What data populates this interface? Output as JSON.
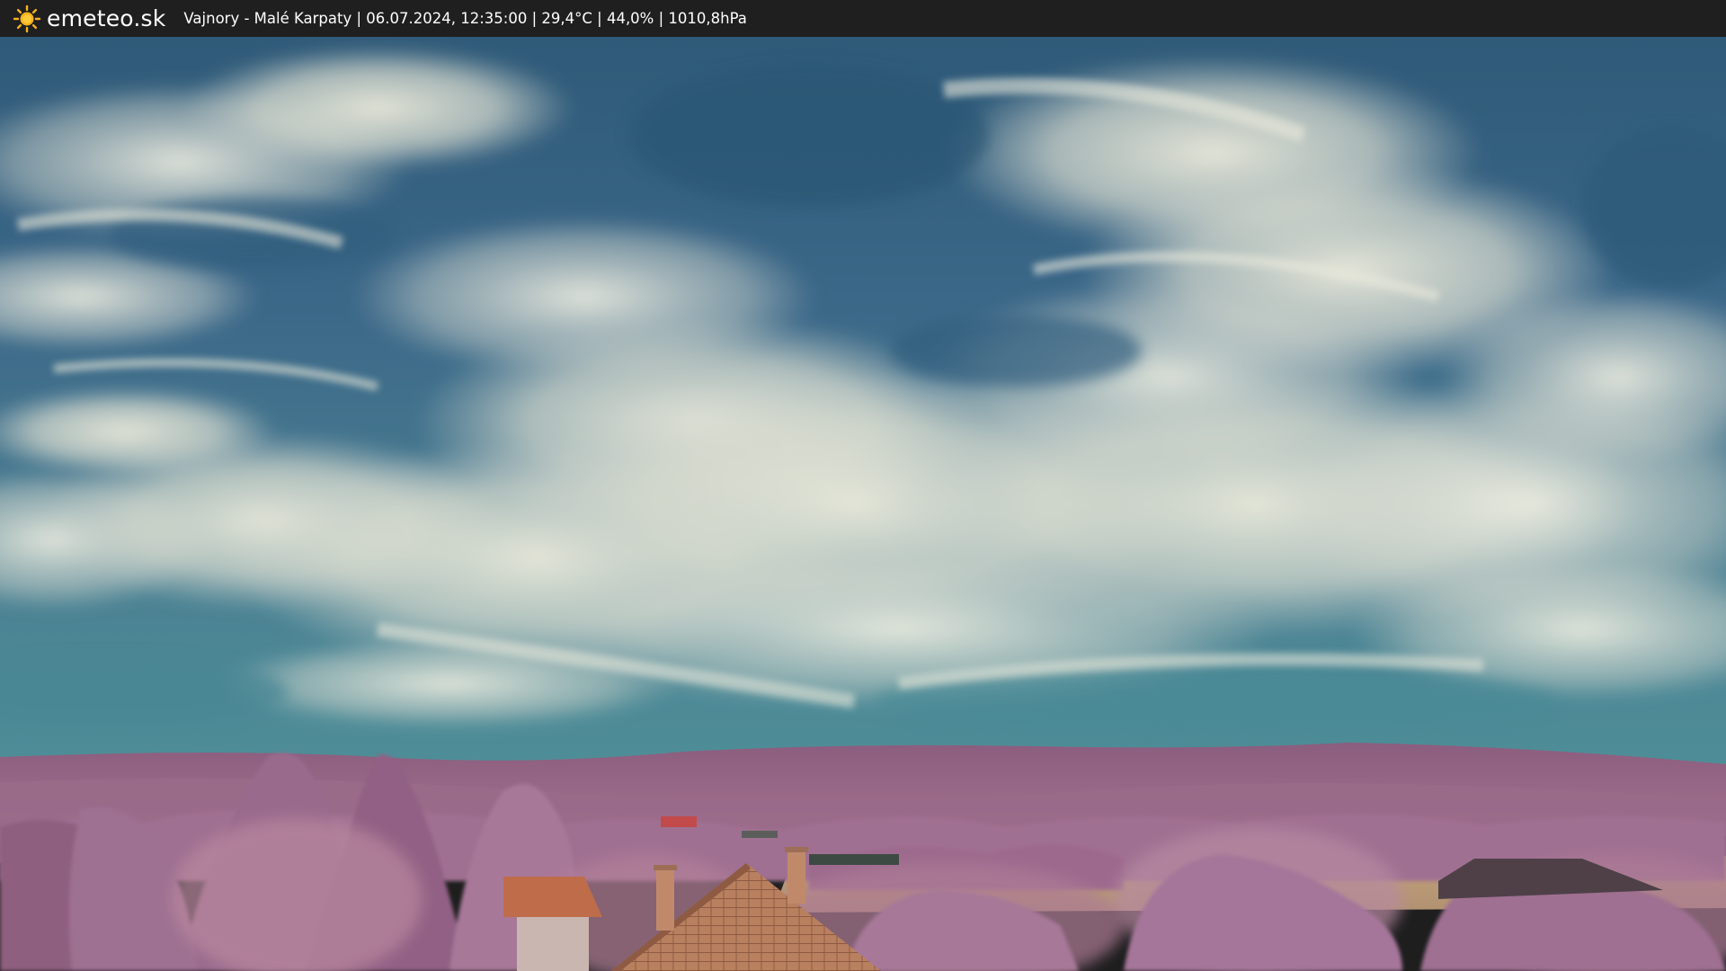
{
  "overlay": {
    "brand": "emeteo.sk",
    "caption": "Vajnory - Malé Karpaty | 06.07.2024, 12:35:00 | 29,4°C | 44,0% | 1010,8hPa"
  },
  "icons": {
    "logo": "sun-icon"
  },
  "colors": {
    "bar_background": "#1f1f1f",
    "bar_text": "#ffffff",
    "sun_yellow": "#f6b21b",
    "sky_blue": "#3e6e8a",
    "vegetation_pink": "#9b6b8d"
  }
}
